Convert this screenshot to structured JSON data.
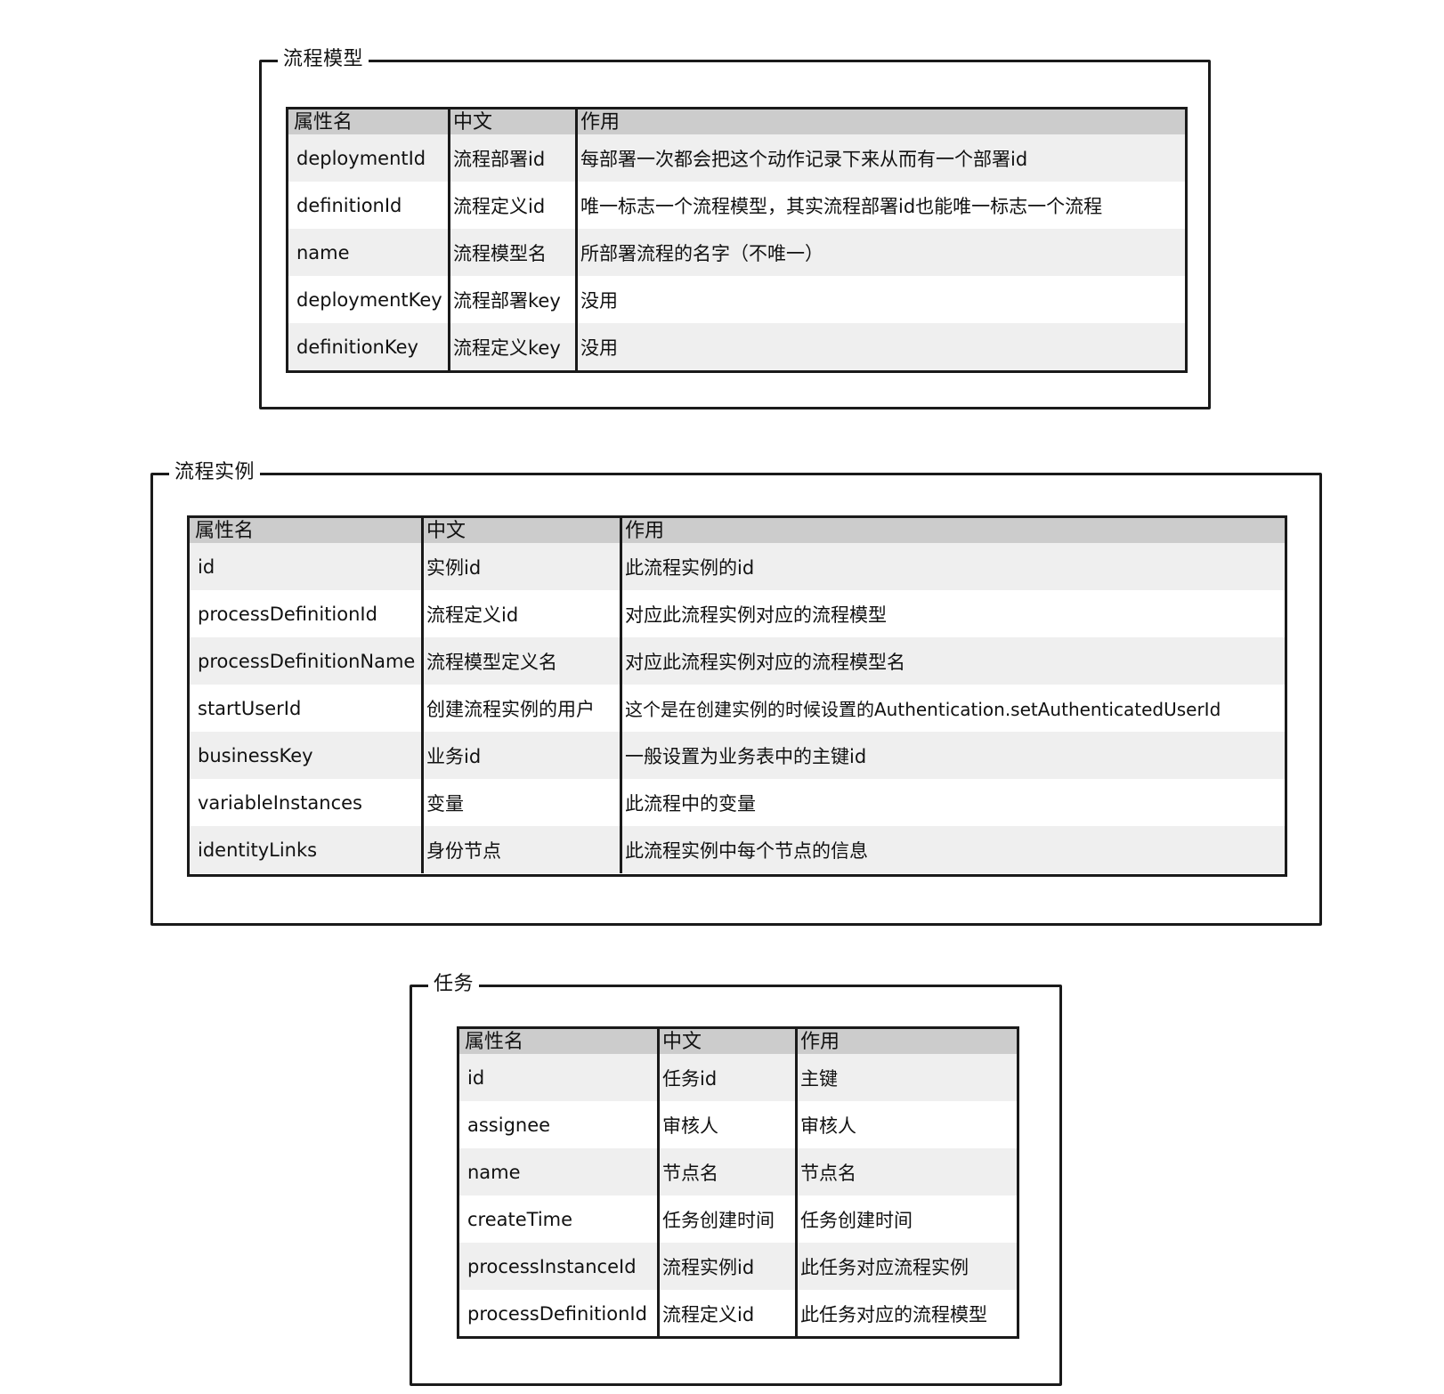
{
  "header_labels": {
    "attr": "属性名",
    "chinese": "中文",
    "purpose": "作用"
  },
  "groups": [
    {
      "title": "流程模型",
      "rows": [
        {
          "attr": "deploymentId",
          "chinese": "流程部署id",
          "purpose": "每部署一次都会把这个动作记录下来从而有一个部署id"
        },
        {
          "attr": "definitionId",
          "chinese": "流程定义id",
          "purpose": "唯一标志一个流程模型，其实流程部署id也能唯一标志一个流程"
        },
        {
          "attr": "name",
          "chinese": "流程模型名",
          "purpose": "所部署流程的名字（不唯一）"
        },
        {
          "attr": "deploymentKey",
          "chinese": "流程部署key",
          "purpose": "没用"
        },
        {
          "attr": "definitionKey",
          "chinese": "流程定义key",
          "purpose": "没用"
        }
      ]
    },
    {
      "title": "流程实例",
      "rows": [
        {
          "attr": "id",
          "chinese": "实例id",
          "purpose": "此流程实例的id"
        },
        {
          "attr": "processDefinitionId",
          "chinese": "流程定义id",
          "purpose": "对应此流程实例对应的流程模型"
        },
        {
          "attr": "processDefinitionName",
          "chinese": "流程模型定义名",
          "purpose": "对应此流程实例对应的流程模型名"
        },
        {
          "attr": "startUserId",
          "chinese": "创建流程实例的用户",
          "purpose": "这个是在创建实例的时候设置的Authentication.setAuthenticatedUserId"
        },
        {
          "attr": "businessKey",
          "chinese": "业务id",
          "purpose": "一般设置为业务表中的主键id"
        },
        {
          "attr": "variableInstances",
          "chinese": "变量",
          "purpose": "此流程中的变量"
        },
        {
          "attr": "identityLinks",
          "chinese": "身份节点",
          "purpose": "此流程实例中每个节点的信息"
        }
      ]
    },
    {
      "title": "任务",
      "rows": [
        {
          "attr": "id",
          "chinese": "任务id",
          "purpose": "主键"
        },
        {
          "attr": "assignee",
          "chinese": "审核人",
          "purpose": "审核人"
        },
        {
          "attr": "name",
          "chinese": "节点名",
          "purpose": "节点名"
        },
        {
          "attr": "createTime",
          "chinese": "任务创建时间",
          "purpose": "任务创建时间"
        },
        {
          "attr": "processInstanceId",
          "chinese": "流程实例id",
          "purpose": "此任务对应流程实例"
        },
        {
          "attr": "processDefinitionId",
          "chinese": "流程定义id",
          "purpose": "此任务对应的流程模型"
        }
      ]
    }
  ]
}
